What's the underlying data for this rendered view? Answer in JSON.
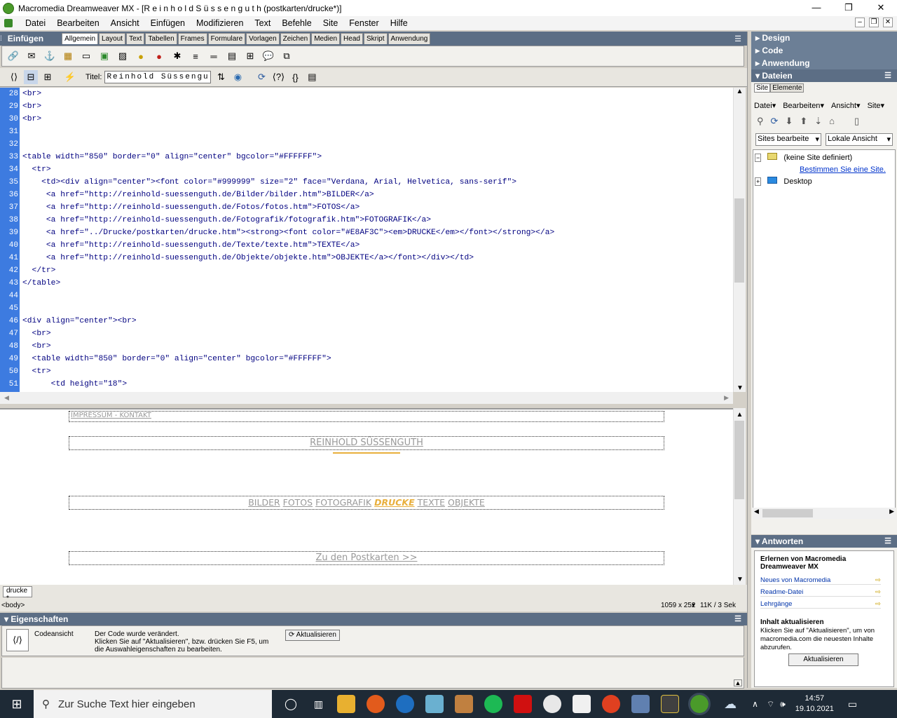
{
  "window": {
    "title": "Macromedia Dreamweaver MX - [R e i n h o l d  S ü s s e n g u t h (postkarten/drucke*)]",
    "controls": [
      "—",
      "❐",
      "✕"
    ]
  },
  "menu": [
    "Datei",
    "Bearbeiten",
    "Ansicht",
    "Einfügen",
    "Modifizieren",
    "Text",
    "Befehle",
    "Site",
    "Fenster",
    "Hilfe"
  ],
  "insert": {
    "label": "Einfügen",
    "tabs": [
      "Allgemein",
      "Layout",
      "Text",
      "Tabellen",
      "Frames",
      "Formulare",
      "Vorlagen",
      "Zeichen",
      "Medien",
      "Head",
      "Skript",
      "Anwendung"
    ],
    "active_tab": "Allgemein"
  },
  "doc_toolbar": {
    "title_label": "Titel:",
    "title_value": "Reinhold Süssenguth"
  },
  "code": [
    {
      "n": "28",
      "t": "<br>"
    },
    {
      "n": "29",
      "t": "<br>"
    },
    {
      "n": "30",
      "t": "<br>"
    },
    {
      "n": "31",
      "t": ""
    },
    {
      "n": "32",
      "t": ""
    },
    {
      "n": "33",
      "t": "<table width=\"850\" border=\"0\" align=\"center\" bgcolor=\"#FFFFFF\">"
    },
    {
      "n": "34",
      "t": "  <tr>"
    },
    {
      "n": "35",
      "t": "    <td><div align=\"center\"><font color=\"#999999\" size=\"2\" face=\"Verdana, Arial, Helvetica, sans-serif\">"
    },
    {
      "n": "36",
      "t": "     <a href=\"http://reinhold-suessenguth.de/Bilder/bilder.htm\">BILDER</a>"
    },
    {
      "n": "37",
      "t": "     <a href=\"http://reinhold-suessenguth.de/Fotos/fotos.htm\">FOTOS</a>"
    },
    {
      "n": "38",
      "t": "     <a href=\"http://reinhold-suessenguth.de/Fotografik/fotografik.htm\">FOTOGRAFIK</a>"
    },
    {
      "n": "39",
      "t": "     <a href=\"../Drucke/postkarten/drucke.htm\"><strong><font color=\"#E8AF3C\"><em>DRUCKE</em></font></strong></a>"
    },
    {
      "n": "40",
      "t": "     <a href=\"http://reinhold-suessenguth.de/Texte/texte.htm\">TEXTE</a>"
    },
    {
      "n": "41",
      "t": "     <a href=\"http://reinhold-suessenguth.de/Objekte/objekte.htm\">OBJEKTE</a></font></div></td>"
    },
    {
      "n": "42",
      "t": "  </tr>"
    },
    {
      "n": "43",
      "t": "</table>"
    },
    {
      "n": "44",
      "t": ""
    },
    {
      "n": "45",
      "t": ""
    },
    {
      "n": "46",
      "t": "<div align=\"center\"><br>"
    },
    {
      "n": "47",
      "t": "  <br>"
    },
    {
      "n": "48",
      "t": "  <br>"
    },
    {
      "n": "49",
      "t": "  <table width=\"850\" border=\"0\" align=\"center\" bgcolor=\"#FFFFFF\">"
    },
    {
      "n": "50",
      "t": "  <tr>"
    },
    {
      "n": "51",
      "t": "      <td height=\"18\">"
    }
  ],
  "design": {
    "impressum": "IMPRESSUM - KONTAKT",
    "name": "REINHOLD SÜSSENGUTH",
    "nav": [
      "BILDER",
      "FOTOS",
      "FOTOGRAFIK",
      "DRUCKE",
      "TEXTE",
      "OBJEKTE"
    ],
    "postkarten_link": "Zu den Postkarten >>"
  },
  "doc_tab": "drucke *",
  "status": {
    "tag": "<body>",
    "size": "1059 x 252",
    "weight": "11K / 3 Sek"
  },
  "properties": {
    "label": "Eigenschaften",
    "view": "Codeansicht",
    "message": "Der Code wurde verändert.\nKlicken Sie auf \"Aktualisieren\", bzw. drücken Sie F5, um die Auswahleigenschaften zu bearbeiten.",
    "refresh": "Aktualisieren"
  },
  "right_panel": {
    "groups": [
      "Design",
      "Code",
      "Anwendung"
    ],
    "files": {
      "label": "Dateien",
      "tabs": [
        "Site",
        "Elemente"
      ],
      "menu": [
        "Datei",
        "Bearbeiten",
        "Ansicht",
        "Site"
      ],
      "site_select": "Sites bearbeite",
      "view_select": "Lokale Ansicht",
      "tree_root": "(keine Site definiert)",
      "tree_link": "Bestimmen Sie eine Site.",
      "tree_desktop": "Desktop"
    },
    "answers": {
      "label": "Antworten",
      "heading": "Erlernen von Macromedia Dreamweaver MX",
      "links": [
        "Neues von Macromedia",
        "Readme-Datei",
        "Lehrgänge"
      ],
      "update_heading": "Inhalt aktualisieren",
      "update_text": "Klicken Sie auf \"Aktualisieren\", um von macromedia.com die neuesten Inhalte abzurufen.",
      "update_button": "Aktualisieren"
    }
  },
  "taskbar": {
    "search_placeholder": "Zur Suche Text hier eingeben",
    "time": "14:57",
    "date": "19.10.2021"
  },
  "colors": {
    "gutter": "#3d7be0",
    "code_text": "#000080",
    "drucke_accent": "#E8AF3C",
    "panel_head": "#5c6e85"
  }
}
